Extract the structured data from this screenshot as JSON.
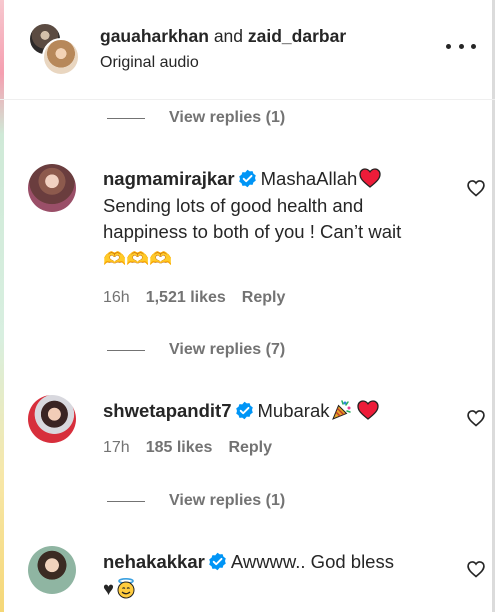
{
  "header": {
    "user1": "gauaharkhan",
    "connector": "and",
    "user2": "zaid_darbar",
    "subtitle": "Original audio",
    "more_icon": "more-horizontal-icon"
  },
  "comments": [
    {
      "username": "nagmamirajkar",
      "verified": true,
      "text_line1": "MashaAllah",
      "text_rest": "Sending lots of good health and happiness to both of you ! Can’t wait 🫶🫶🫶",
      "time": "16h",
      "likes": "1,521 likes",
      "reply": "Reply"
    },
    {
      "username": "shwetapandit7",
      "verified": true,
      "text_line1": "Mubarak",
      "time": "17h",
      "likes": "185 likes",
      "reply": "Reply"
    },
    {
      "username": "nehakakkar",
      "verified": true,
      "text_line1": "Awwww.. God bless",
      "text_line2": "♥"
    }
  ],
  "view_replies": [
    "View replies (1)",
    "View replies (7)",
    "View replies (1)"
  ],
  "colors": {
    "text": "#262626",
    "muted": "#737373",
    "verified": "#0095f6",
    "heart": "#ed1c39"
  }
}
